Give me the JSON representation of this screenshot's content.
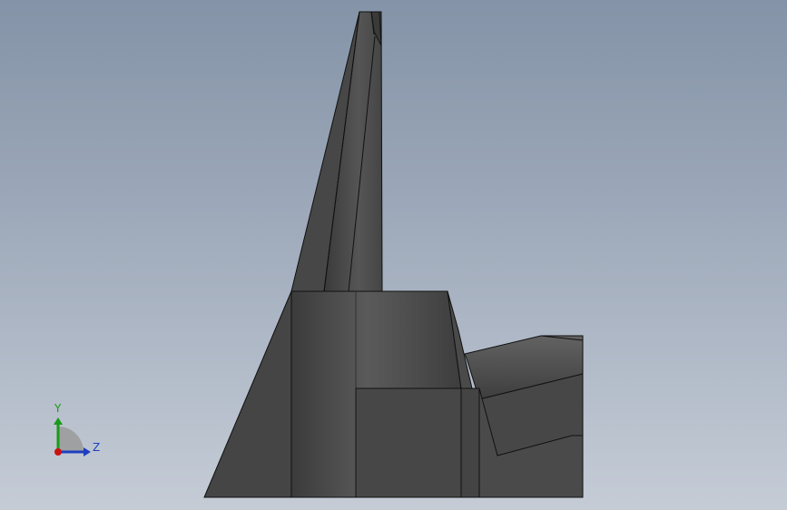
{
  "viewport": {
    "background_top": "#8493a7",
    "background_bottom": "#c5ccd6"
  },
  "model": {
    "face_dark": "#3e3e3e",
    "face_mid": "#4f4f4f",
    "face_light": "#5c5c5c",
    "edge": "#111111"
  },
  "triad": {
    "y_label": "Y",
    "z_label": "Z",
    "y_color": "#1a9a1a",
    "z_color": "#1f3fbf",
    "origin_color": "#cc1111"
  }
}
